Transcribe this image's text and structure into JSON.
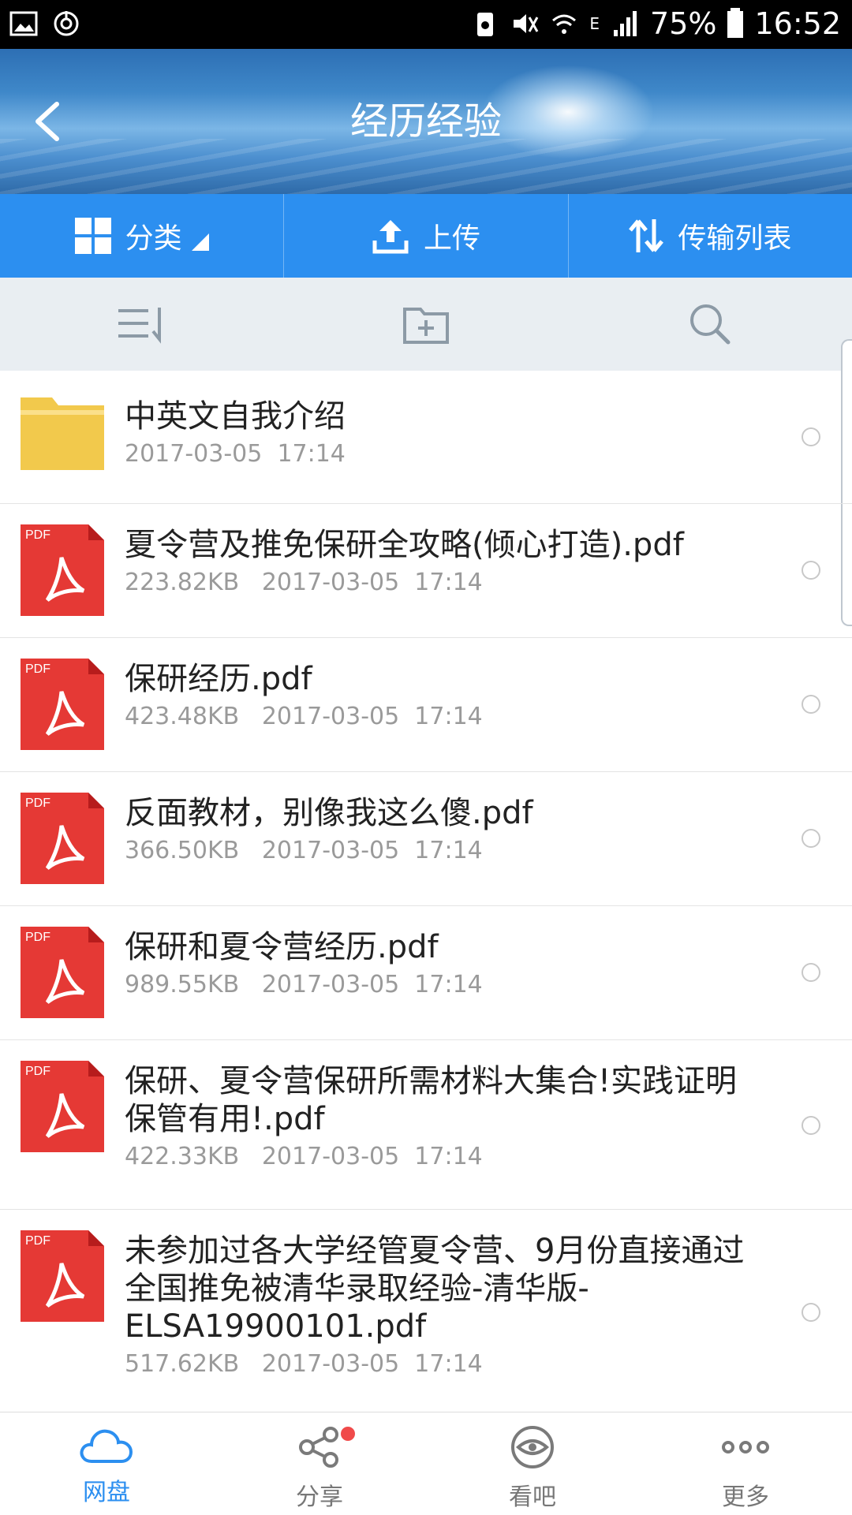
{
  "status_bar": {
    "battery": "75%",
    "time": "16:52",
    "network": "E"
  },
  "header": {
    "title": "经历经验"
  },
  "toolbar": {
    "category_label": "分类",
    "upload_label": "上传",
    "transfer_label": "传输列表"
  },
  "files": [
    {
      "type": "folder",
      "name": "中英文自我介绍",
      "size": "",
      "date": "2017-03-05",
      "time": "17:14"
    },
    {
      "type": "pdf",
      "name": "夏令营及推免保研全攻略(倾心打造).pdf",
      "size": "223.82KB",
      "date": "2017-03-05",
      "time": "17:14"
    },
    {
      "type": "pdf",
      "name": "保研经历.pdf",
      "size": "423.48KB",
      "date": "2017-03-05",
      "time": "17:14"
    },
    {
      "type": "pdf",
      "name": "反面教材，别像我这么傻.pdf",
      "size": "366.50KB",
      "date": "2017-03-05",
      "time": "17:14"
    },
    {
      "type": "pdf",
      "name": "保研和夏令营经历.pdf",
      "size": "989.55KB",
      "date": "2017-03-05",
      "time": "17:14"
    },
    {
      "type": "pdf",
      "name": "保研、夏令营保研所需材料大集合!实践证明保管有用!.pdf",
      "size": "422.33KB",
      "date": "2017-03-05",
      "time": "17:14"
    },
    {
      "type": "pdf",
      "name": "未参加过各大学经管夏令营、9月份直接通过全国推免被清华录取经验-清华版-ELSA19900101.pdf",
      "size": "517.62KB",
      "date": "2017-03-05",
      "time": "17:14"
    }
  ],
  "pdf_badge": "PDF",
  "bottom_nav": [
    {
      "label": "网盘",
      "icon": "cloud-icon",
      "active": true
    },
    {
      "label": "分享",
      "icon": "share-icon",
      "active": false
    },
    {
      "label": "看吧",
      "icon": "eye-icon",
      "active": false
    },
    {
      "label": "更多",
      "icon": "more-icon",
      "active": false
    }
  ],
  "colors": {
    "accent": "#2c8ff0",
    "pdf_red": "#e53935",
    "folder_yellow": "#f2c94c",
    "badge_red": "#f04a4a"
  }
}
